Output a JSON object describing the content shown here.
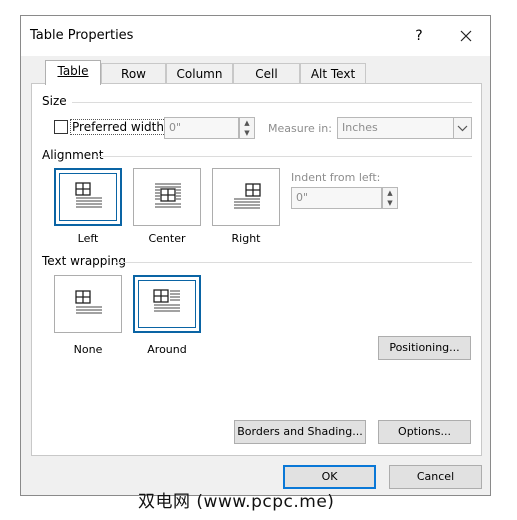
{
  "window": {
    "title": "Table Properties",
    "help": "?",
    "close": "✕"
  },
  "tabs": [
    {
      "label": "Table",
      "active": true
    },
    {
      "label": "Row",
      "active": false
    },
    {
      "label": "Column",
      "active": false
    },
    {
      "label": "Cell",
      "active": false
    },
    {
      "label": "Alt Text",
      "active": false
    }
  ],
  "size": {
    "heading": "Size",
    "preferred_width_label": "Preferred width:",
    "preferred_width_value": "0\"",
    "measure_in_label": "Measure in:",
    "measure_in_value": "Inches"
  },
  "alignment": {
    "heading": "Alignment",
    "options": [
      "Left",
      "Center",
      "Right"
    ],
    "selected": "Left",
    "indent_label": "Indent from left:",
    "indent_value": "0\""
  },
  "wrapping": {
    "heading": "Text wrapping",
    "options": [
      "None",
      "Around"
    ],
    "selected": "Around",
    "positioning_button": "Positioning..."
  },
  "buttons": {
    "borders": "Borders and Shading...",
    "options": "Options...",
    "ok": "OK",
    "cancel": "Cancel"
  },
  "watermark": "双电网 (www.pcpc.me)",
  "colors": {
    "accent": "#0a64a4",
    "primary_border": "#0a78d7"
  }
}
